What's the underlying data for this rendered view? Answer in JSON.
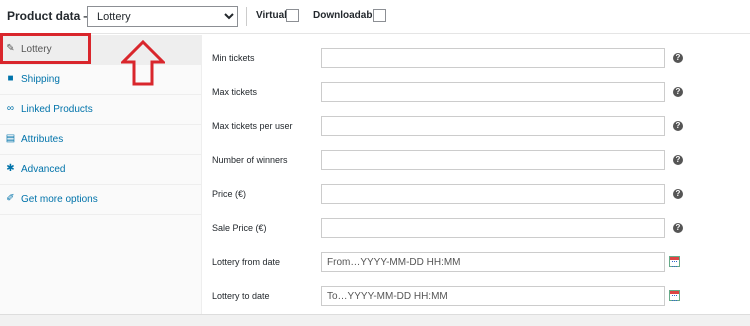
{
  "header": {
    "title": "Product data —",
    "product_type": "Lottery",
    "virtual_label": "Virtual:",
    "downloadable_label": "Downloadable:"
  },
  "tabs": [
    {
      "label": "Lottery",
      "icon": "ticket-icon",
      "active": true
    },
    {
      "label": "Shipping",
      "icon": "truck-icon"
    },
    {
      "label": "Linked Products",
      "icon": "link-icon"
    },
    {
      "label": "Attributes",
      "icon": "list-icon"
    },
    {
      "label": "Advanced",
      "icon": "gear-icon"
    },
    {
      "label": "Get more options",
      "icon": "plugin-icon"
    }
  ],
  "fields": [
    {
      "label": "Min tickets",
      "value": "",
      "placeholder": ""
    },
    {
      "label": "Max tickets",
      "value": "",
      "placeholder": ""
    },
    {
      "label": "Max tickets per user",
      "value": "",
      "placeholder": ""
    },
    {
      "label": "Number of winners",
      "value": "",
      "placeholder": ""
    },
    {
      "label": "Price (€)",
      "value": "",
      "placeholder": ""
    },
    {
      "label": "Sale Price (€)",
      "value": "",
      "placeholder": ""
    },
    {
      "label": "Lottery from date",
      "value": "",
      "placeholder": "From…YYYY-MM-DD HH:MM"
    },
    {
      "label": "Lottery to date",
      "value": "",
      "placeholder": "To…YYYY-MM-DD HH:MM"
    }
  ],
  "colors": {
    "highlight": "#d9262c",
    "link": "#0073aa"
  }
}
